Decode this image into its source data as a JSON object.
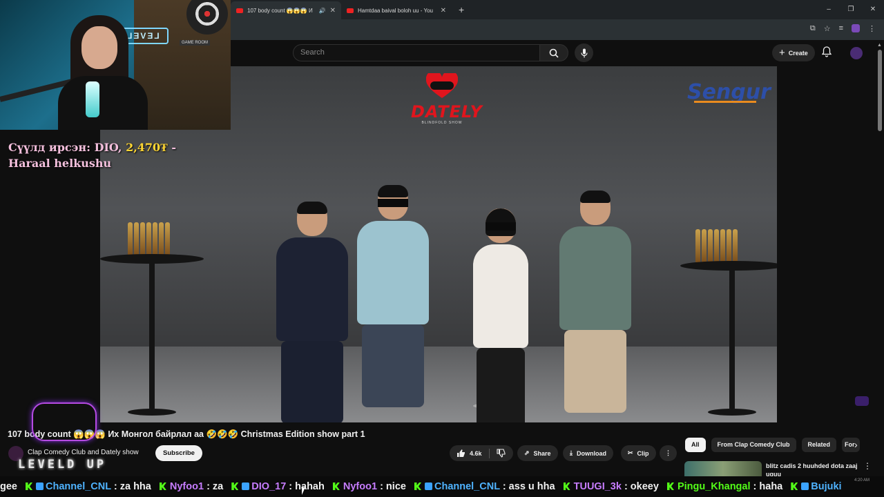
{
  "browser": {
    "tabs": [
      {
        "title": "107 body count 😱😱😱 И",
        "active": true
      },
      {
        "title": "Hamtdaa baival boloh uu - You",
        "active": false
      }
    ],
    "new_tab": "+",
    "window_controls": [
      "–",
      "❐",
      "✕"
    ]
  },
  "masthead": {
    "search_placeholder": "Search",
    "create_label": "Create"
  },
  "video": {
    "brand_logo_text": "DATELY",
    "brand_sub_text": "BLINDFOLD SHOW",
    "sponsor_text": "Sengur"
  },
  "webcam": {
    "neon_sign": "LEVELD",
    "room_sign": "GAME ROOM"
  },
  "donation": {
    "prefix": "Сүүлд ирсэн: DIO, ",
    "amount": "2,470₮",
    "suffix": " -",
    "message": "Haraal helkushu"
  },
  "watch": {
    "title": "107 body count 😱😱😱 Их Монгол байрлал аа 🤣🤣🤣 Christmas Edition show part 1",
    "channel": "Clap Comedy Club and Dately show",
    "subscribe": "Subscribe",
    "likes": "4.6k",
    "share": "Share",
    "download": "Download",
    "clip": "Clip",
    "more": "⋮"
  },
  "chips": [
    "All",
    "From Clap Comedy Club",
    "Related",
    "For"
  ],
  "recommended": {
    "title": "blitz cadis 2 huuhded dota zaaj uguu"
  },
  "stream_logo": "LEVELD UP",
  "chat_ticker": [
    {
      "user": "gee",
      "text": ""
    },
    {
      "user": "Channel_CNL",
      "text": ": za hha"
    },
    {
      "user": "Nyfoo1",
      "text": ": za"
    },
    {
      "user": "DIO_17",
      "text": ": hahah"
    },
    {
      "user": "Nyfoo1",
      "text": ": nice"
    },
    {
      "user": "Channel_CNL",
      "text": ": ass u hha"
    },
    {
      "user": "TUUGI_3k",
      "text": ": okeey"
    },
    {
      "user": "Pingu_Khangal",
      "text": ": haha"
    },
    {
      "user": "Bujuki",
      "text": ""
    }
  ],
  "tray_clock": "4:20 AM"
}
